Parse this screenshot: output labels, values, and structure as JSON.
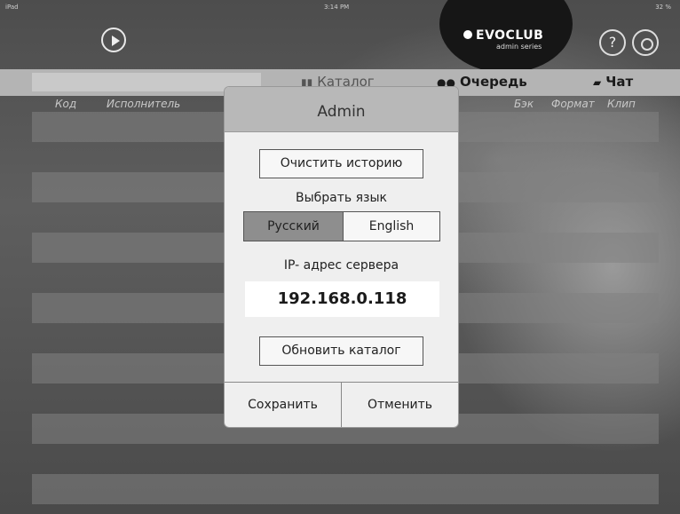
{
  "status_bar": {
    "carrier": "iPad",
    "time": "3:14 PM",
    "battery": "32 %"
  },
  "header": {
    "logo_brand": "EVOCLUB",
    "logo_sub": "admin series",
    "help_label": "?"
  },
  "nav": {
    "search_value": "",
    "tabs": [
      {
        "label": "Каталог"
      },
      {
        "label": "Очередь"
      },
      {
        "label": "Чат"
      }
    ]
  },
  "columns": [
    "Код",
    "Исполнитель",
    "Бэк",
    "Формат",
    "Клип"
  ],
  "modal": {
    "title": "Admin",
    "clear_history": "Очистить историю",
    "choose_language": "Выбрать язык",
    "languages": [
      "Русский",
      "English"
    ],
    "selected_language": "Русский",
    "ip_label": "IP- адрес сервера",
    "ip_value": "192.168.0.118",
    "refresh_catalog": "Обновить каталог",
    "save": "Сохранить",
    "cancel": "Отменить"
  },
  "colors": {
    "accent_header": "#b8b8b8",
    "selected_segment": "#8e8e8e"
  }
}
